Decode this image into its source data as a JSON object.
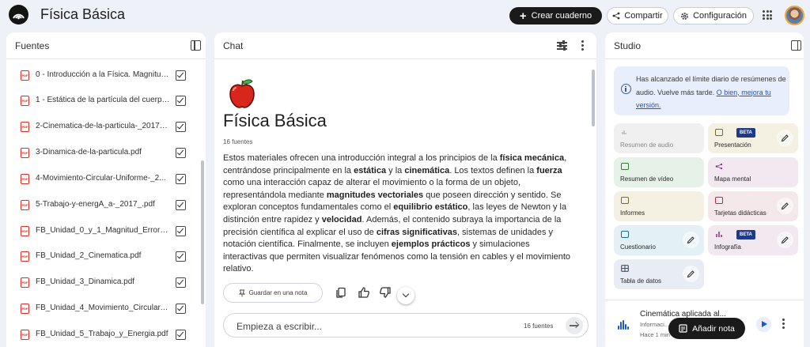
{
  "app": {
    "title": "Física Básica",
    "create_button": "Crear cuaderno",
    "share_button": "Compartir",
    "config_button": "Configuración"
  },
  "sources": {
    "title": "Fuentes",
    "items": [
      {
        "name": "0 - Introducción a la Física. Magnitud..."
      },
      {
        "name": "1 - Estática de la partícula del cuerpo..."
      },
      {
        "name": "2-Cinematica-de-la-particula-_2017_..."
      },
      {
        "name": "3-Dinamica-de-la-particula.pdf"
      },
      {
        "name": "4-Movimiento-Circular-Uniforme-_2..."
      },
      {
        "name": "5-Trabajo-y-energÃ_a-_2017_.pdf"
      },
      {
        "name": "FB_Unidad_0_y_1_Magnitud_Error_Ve..."
      },
      {
        "name": "FB_Unidad_2_Cinematica.pdf"
      },
      {
        "name": "FB_Unidad_3_Dinamica.pdf"
      },
      {
        "name": "FB_Unidad_4_Movimiento_Circular.pdf"
      },
      {
        "name": "FB_Unidad_5_Trabajo_y_Energia.pdf"
      }
    ]
  },
  "chat": {
    "title": "Chat",
    "notebook_title": "Física Básica",
    "source_count": "16 fuentes",
    "summary_segments": [
      {
        "text": "Estos materiales ofrecen una introducción integral a los principios de la ",
        "bold": false
      },
      {
        "text": "física mecánica",
        "bold": true
      },
      {
        "text": ", centrándose principalmente en la ",
        "bold": false
      },
      {
        "text": "estática",
        "bold": true
      },
      {
        "text": " y la ",
        "bold": false
      },
      {
        "text": "cinemática",
        "bold": true
      },
      {
        "text": ". Los textos definen la ",
        "bold": false
      },
      {
        "text": "fuerza",
        "bold": true
      },
      {
        "text": " como una interacción capaz de alterar el movimiento o la forma de un objeto, representándola mediante ",
        "bold": false
      },
      {
        "text": "magnitudes vectoriales",
        "bold": true
      },
      {
        "text": " que poseen dirección y sentido. Se exploran conceptos fundamentales como el ",
        "bold": false
      },
      {
        "text": "equilibrio estático",
        "bold": true
      },
      {
        "text": ", las leyes de Newton y la distinción entre rapidez y ",
        "bold": false
      },
      {
        "text": "velocidad",
        "bold": true
      },
      {
        "text": ". Además, el contenido subraya la importancia de la precisión científica al explicar el uso de ",
        "bold": false
      },
      {
        "text": "cifras significativas",
        "bold": true
      },
      {
        "text": ", sistemas de unidades y notación científica. Finalmente, se incluyen ",
        "bold": false
      },
      {
        "text": "ejemplos prácticos",
        "bold": true
      },
      {
        "text": " y simulaciones interactivas que permiten visualizar fenómenos como la tensión en cables y el movimiento relativo.",
        "bold": false
      }
    ],
    "save_note": "Guardar en una nota",
    "input_placeholder": "Empieza a escribir...",
    "input_count": "16 fuentes"
  },
  "studio": {
    "title": "Studio",
    "alert_text": "Has alcanzado el límite diario de resúmenes de audio. Vuelve más tarde. ",
    "alert_link": "O bien, mejora tu versión.",
    "tiles": {
      "audio": "Resumen de audio",
      "presentacion": "Presentación",
      "video": "Resumen de vídeo",
      "mapa": "Mapa mental",
      "informes": "Informes",
      "tarjetas": "Tarjetas didácticas",
      "cuestionario": "Cuestionario",
      "infografia": "Infografía",
      "tabla": "Tabla de datos"
    },
    "beta_label": "BETA",
    "note": {
      "title": "Cinemática aplicada al...",
      "subtitle": "Informaci...",
      "time": "Hace 1 min"
    },
    "add_note": "Añadir nota"
  },
  "colors": {
    "accent_blue": "#1a56c9",
    "dark_button": "#1a1a1a",
    "pdf_red": "#d93025",
    "page_background": "#eef1f8"
  },
  "icons": {
    "logo": "notebooklm-logo-icon",
    "share": "share-icon",
    "config": "gear-icon",
    "apps": "apps-grid-icon",
    "source_file": "pdf-icon",
    "tune": "tune-icon",
    "copy": "copy-icon",
    "like": "thumb-up-icon",
    "dislike": "thumb-down-icon",
    "send": "arrow-right-icon",
    "audio_note": "waveform-icon",
    "play": "play-icon"
  }
}
